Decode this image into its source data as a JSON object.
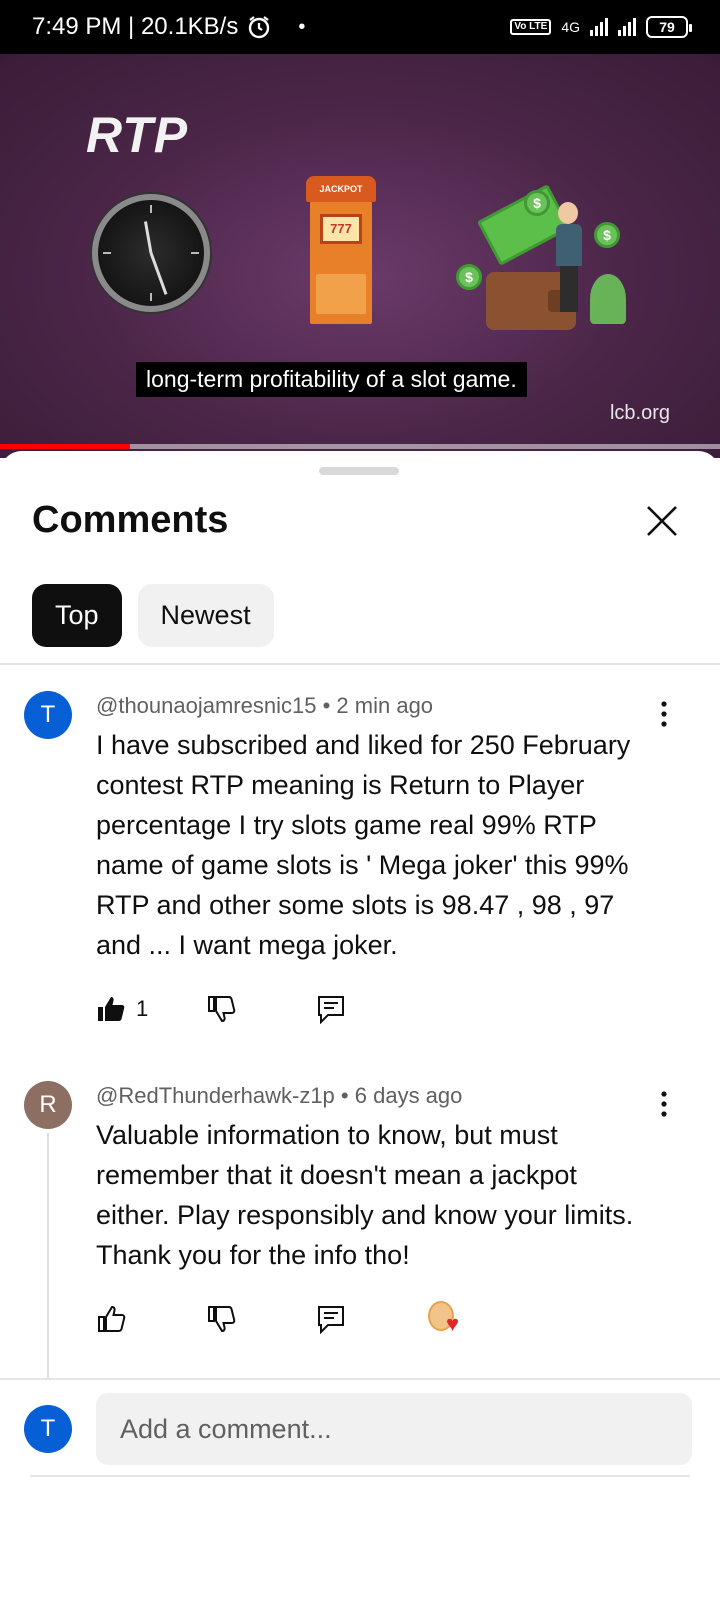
{
  "status_bar": {
    "time_speed": "7:49 PM | 20.1KB/s",
    "network": "4G",
    "volte": "Vo LTE",
    "battery": "79"
  },
  "video": {
    "overlay_title": "RTP",
    "slot_label": "JACKPOT",
    "slot_digits": "777",
    "subtitle": "long-term profitability of a slot game.",
    "watermark": "lcb.org",
    "progress_fraction": 0.18
  },
  "comments_panel": {
    "title": "Comments",
    "tabs": [
      {
        "label": "Top",
        "active": true
      },
      {
        "label": "Newest",
        "active": false
      }
    ],
    "comments": [
      {
        "avatar_letter": "T",
        "avatar_color": "#065fd4",
        "author": "@thounaojamresnic15",
        "time": "2 min ago",
        "text": "I have subscribed and liked for 250 February contest RTP meaning is Return to Player percentage I try slots game real 99% RTP name of game slots is ' Mega joker' this 99% RTP and other some slots is 98.47 , 98 , 97 and ... I want mega joker.",
        "likes": "1",
        "liked": true
      },
      {
        "avatar_letter": "R",
        "avatar_color": "#8d6e63",
        "author": "@RedThunderhawk-z1p",
        "time": "6 days ago",
        "text": "Valuable information to know, but must remember that it doesn't mean a jackpot either. Play responsibly and know your limits. Thank you for the info tho!",
        "likes": "",
        "liked": false,
        "creator_heart": true
      }
    ],
    "add_comment": {
      "avatar_letter": "T",
      "placeholder": "Add a comment..."
    }
  },
  "colors": {
    "brand_red": "#ff0000",
    "chip_active": "#0f0f0f",
    "chip_inactive": "#f1f1f1",
    "text_secondary": "#606060"
  }
}
